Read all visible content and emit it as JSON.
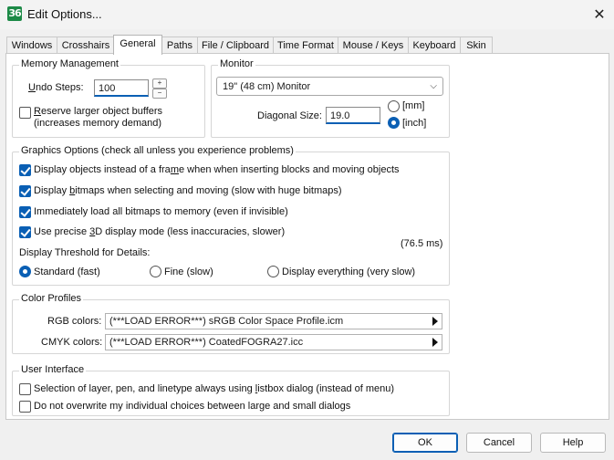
{
  "window": {
    "title": "Edit Options...",
    "app_icon_text": "36"
  },
  "tabs": [
    {
      "label": "Windows"
    },
    {
      "label": "Crosshairs"
    },
    {
      "label": "General",
      "active": true
    },
    {
      "label": "Paths"
    },
    {
      "label": "File / Clipboard"
    },
    {
      "label": "Time Format"
    },
    {
      "label": "Mouse / Keys"
    },
    {
      "label": "Keyboard"
    },
    {
      "label": "Skin"
    }
  ],
  "memory": {
    "legend": "Memory Management",
    "undo_label_u": "U",
    "undo_label_rest": "ndo Steps:",
    "undo_value": "100",
    "reserve_u": "R",
    "reserve_rest": "eserve larger object buffers",
    "reserve_line2": "(increases memory demand)",
    "reserve_checked": false
  },
  "monitor": {
    "legend": "Monitor",
    "selected": "19\" (48 cm) Monitor",
    "diag_label": "Diagonal Size:",
    "diag_value": "19.0",
    "unit_mm": "[mm]",
    "unit_inch": "[inch]",
    "selected_unit": "inch"
  },
  "graphics": {
    "legend": "Graphics Options (check all unless you experience problems)",
    "opt1_a": "Display objects instead of a fra",
    "opt1_u": "m",
    "opt1_b": "e when when inserting blocks and moving objects",
    "opt2_a": "Display ",
    "opt2_u": "b",
    "opt2_b": "itmaps when selecting and moving (slow with huge bitmaps)",
    "opt3": "Immediately load all bitmaps to memory (even if invisible)",
    "opt4_a": "Use precise ",
    "opt4_u": "3",
    "opt4_b": "D display mode (less inaccuracies, slower)",
    "timing": "(76.5 ms)",
    "threshold_label": "Display Threshold for Details:",
    "thr_standard": "Standard (fast)",
    "thr_fine": "Fine (slow)",
    "thr_everything": "Display everything (very slow)",
    "selected_threshold": "Standard (fast)"
  },
  "color_profiles": {
    "legend": "Color Profiles",
    "rgb_label": "RGB colors:",
    "rgb_value": "(***LOAD ERROR***) sRGB Color Space Profile.icm",
    "cmyk_label": "CMYK colors:",
    "cmyk_value": "(***LOAD ERROR***) CoatedFOGRA27.icc"
  },
  "ui": {
    "legend": "User Interface",
    "opt1_a": "Selection of layer, pen, and linetype always using ",
    "opt1_u": "l",
    "opt1_b": "istbox dialog (instead of menu)",
    "opt2": "Do not overwrite my individual choices between large and small dialogs"
  },
  "buttons": {
    "ok": "OK",
    "cancel": "Cancel",
    "help": "Help"
  },
  "colors": {
    "accent": "#0a5fb4",
    "brand_icon": "#1d8a47"
  }
}
